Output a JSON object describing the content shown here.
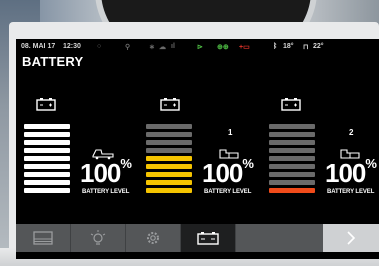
{
  "status_bar": {
    "date": "08. MAI 17",
    "time": "12:30",
    "temp_left": "18°",
    "temp_right": "22°"
  },
  "page_title": "BATTERY",
  "batteries": [
    {
      "id": "main",
      "vehicle_label": "",
      "percent": "100",
      "percent_sign": "%",
      "level_label": "BATTERY LEVEL",
      "bars": [
        "w",
        "w",
        "w",
        "w",
        "w",
        "w",
        "w",
        "w",
        "w"
      ]
    },
    {
      "id": "1",
      "vehicle_label": "1",
      "percent": "100",
      "percent_sign": "%",
      "level_label": "BATTERY LEVEL",
      "bars": [
        "d",
        "d",
        "d",
        "d",
        "y",
        "y",
        "y",
        "y",
        "y"
      ]
    },
    {
      "id": "2",
      "vehicle_label": "2",
      "percent": "100",
      "percent_sign": "%",
      "level_label": "BATTERY LEVEL",
      "bars": [
        "d",
        "d",
        "d",
        "d",
        "d",
        "d",
        "d",
        "d",
        "o"
      ]
    }
  ],
  "colors": {
    "full": "#ffffff",
    "empty": "#6a6a6a",
    "medium": "#f5c400",
    "low": "#f04b1a",
    "nav_background": "#545658",
    "nav_active": "#1e1f20"
  },
  "nav": [
    {
      "name": "display",
      "icon": "screen-icon",
      "active": false
    },
    {
      "name": "lighting",
      "icon": "light-bulb-icon",
      "active": false
    },
    {
      "name": "settings",
      "icon": "gear-icon",
      "active": false
    },
    {
      "name": "battery",
      "icon": "battery-icon",
      "active": true
    }
  ]
}
